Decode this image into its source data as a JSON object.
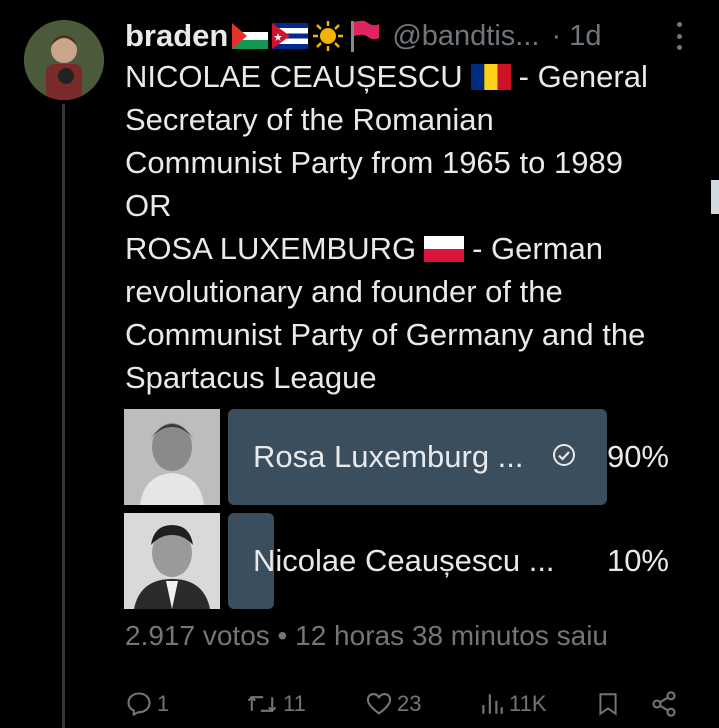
{
  "tweet": {
    "author": "braden",
    "handle": "@bandtis...",
    "time": "· 1d",
    "text_lines": [
      "NICOLAE CEAUȘESCU",
      "- General",
      "Secretary of the Romanian",
      "Communist Party from 1965 to 1989",
      "OR",
      "ROSA LUXEMBURG",
      "- German",
      "revolutionary and founder of the",
      "Communist Party of Germany and the",
      "Spartacus League"
    ]
  },
  "poll": {
    "options": [
      {
        "label": "Rosa Luxemburg ...",
        "percent": "90%",
        "share": 0.9,
        "winner": true
      },
      {
        "label": "Nicolae Ceaușescu ...",
        "percent": "10%",
        "share": 0.1,
        "winner": false
      }
    ],
    "meta": "2.917 votos • 12 horas 38 minutos saiu"
  },
  "actions": {
    "replies": "1",
    "reposts": "11",
    "likes": "23",
    "views": "11K"
  },
  "colors": {
    "background": "#000000",
    "text": "#e7e9ea",
    "muted": "#71767b",
    "poll_bar": "#3b4e5e"
  }
}
